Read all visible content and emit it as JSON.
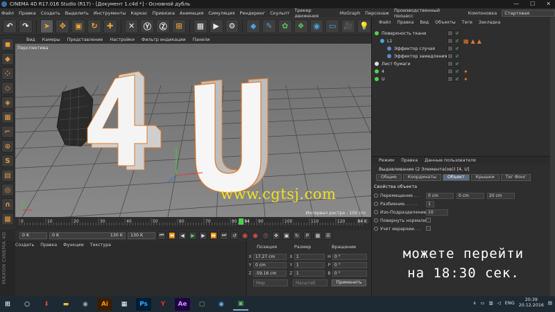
{
  "window": {
    "title": "CINEMA 4D R17.016 Studio (R17) - [Документ 1.c4d *] - Основной дубль",
    "min_glyph": "—",
    "max_glyph": "☐",
    "close_glyph": "✕"
  },
  "menubar": {
    "items": [
      "Файл",
      "Правка",
      "Создать",
      "Выделить",
      "Инструменты",
      "Каркас",
      "Привязка",
      "Анимация",
      "Симуляция",
      "Рендеринг",
      "Скульпт",
      "Трекер движения",
      "MoGraph",
      "Персонаж",
      "Производственный процесс",
      "Компоновка"
    ],
    "layout_value": "Стартовая"
  },
  "toolbar": {
    "icons": [
      "undo-icon",
      "redo-icon",
      "select-icon",
      "move-icon",
      "scale-icon",
      "rotate-icon",
      "add-icon",
      "x-axis-icon",
      "y-axis-icon",
      "z-axis-icon",
      "world-icon",
      "render-view-icon",
      "render-icon",
      "render-settings-icon",
      "cube-icon",
      "spline-pen-icon",
      "subdivision-icon",
      "array-icon",
      "deformer-icon",
      "floor-icon",
      "camera-icon",
      "light-icon"
    ]
  },
  "left_tools": [
    "model-mode-icon",
    "object-mode-icon",
    "points-mode-icon",
    "edges-mode-icon",
    "polygons-mode-icon",
    "uv-mode-icon",
    "axis-mode-icon",
    "tweak-icon",
    "snap-icon",
    "workplane-icon",
    "soft-select-icon",
    "magnet-icon",
    "lock-icon"
  ],
  "viewport": {
    "menu": [
      "Вид",
      "Камеры",
      "Представление",
      "Настройки",
      "Фильтр индикации",
      "Панели"
    ],
    "label": "Перспектива",
    "grid_info": "Интервал растра : 100 cm",
    "watermark": "www.cgtsj.com",
    "text_4": "4",
    "text_u": "U"
  },
  "timeline": {
    "ticks": [
      "0",
      "10",
      "20",
      "30",
      "40",
      "50",
      "60",
      "70",
      "80",
      "90",
      "100",
      "110",
      "120",
      "13"
    ],
    "current_frame": "84",
    "end_frame_label": "84 K",
    "frame_start": "0 K",
    "frame_min": "0 K",
    "frame_max": "130 K",
    "frame_end": "130 K"
  },
  "material_menu": [
    "Создать",
    "Правка",
    "Функции",
    "Текстура"
  ],
  "maxon_logo": "MAXON CINEMA 4D",
  "coords": {
    "headers": [
      "Позиция",
      "Размер",
      "Вращение"
    ],
    "rows": [
      {
        "axis": "X",
        "pos": "17.27 cm",
        "size": "1",
        "rot_axis": "H",
        "rot": "0 °"
      },
      {
        "axis": "Y",
        "pos": "0 cm",
        "size": "1",
        "rot_axis": "P",
        "rot": "0 °"
      },
      {
        "axis": "Z",
        "pos": "-59.16 cm",
        "size": "1",
        "rot_axis": "B",
        "rot": "0 °"
      }
    ],
    "mode1": "Мир",
    "mode2": "Масштаб",
    "apply": "Применить"
  },
  "objects": {
    "menu": [
      "Файл",
      "Правка",
      "Вид",
      "Объекты",
      "Теги",
      "Закладка"
    ],
    "rows": [
      {
        "name": "Поверхность ткани",
        "indent": 0
      },
      {
        "name": "L1",
        "indent": 1
      },
      {
        "name": "Эффектор случая",
        "indent": 2
      },
      {
        "name": "Эффектор замедления",
        "indent": 2
      },
      {
        "name": "Лист бумаги",
        "indent": 0
      },
      {
        "name": "4",
        "indent": 0
      },
      {
        "name": "U",
        "indent": 0
      }
    ]
  },
  "attributes": {
    "menu": [
      "Режим",
      "Правка",
      "Данные пользователя"
    ],
    "title": "Выдавливание (2 Элемента(ов)) [4, U]",
    "tabs": [
      "Общие",
      "Координаты",
      "Объект",
      "Крышки",
      "Тег Фонг"
    ],
    "active_tab": "Объект",
    "section": "Свойства объекта",
    "fields": [
      {
        "label": "Перемещение . .",
        "values": [
          "0 cm",
          "0 cm",
          "20 cm"
        ]
      },
      {
        "label": "Разбиение. . . . .",
        "values": [
          "1"
        ]
      },
      {
        "label": "Изо-Подразделение",
        "values": [
          "10"
        ]
      },
      {
        "label": "Повернуть нормали",
        "values": []
      },
      {
        "label": "Учет иерархии. . .",
        "values": []
      }
    ]
  },
  "overlay": {
    "line1": "можете перейти",
    "line2": "на 18:30 сек."
  },
  "taskbar": {
    "apps": [
      "windows-start-icon",
      "search-icon",
      "download-icon",
      "explorer-icon",
      "steam-icon",
      "illustrator-icon",
      "media-icon",
      "photoshop-icon",
      "yandex-icon",
      "after-effects-icon",
      "camtasia-icon",
      "cinema4d-icon",
      "camtasia-recorder-icon"
    ],
    "app_letters": {
      "illustrator": "Ai",
      "photoshop": "Ps",
      "after_effects": "Ae"
    },
    "lang": "ENG",
    "time": "20:39",
    "date": "20.12.2016"
  },
  "colors": {
    "accent_orange": "#e8a33a",
    "watermark_yellow": "#f2e020",
    "active_tab_blue": "#5a6a80"
  }
}
